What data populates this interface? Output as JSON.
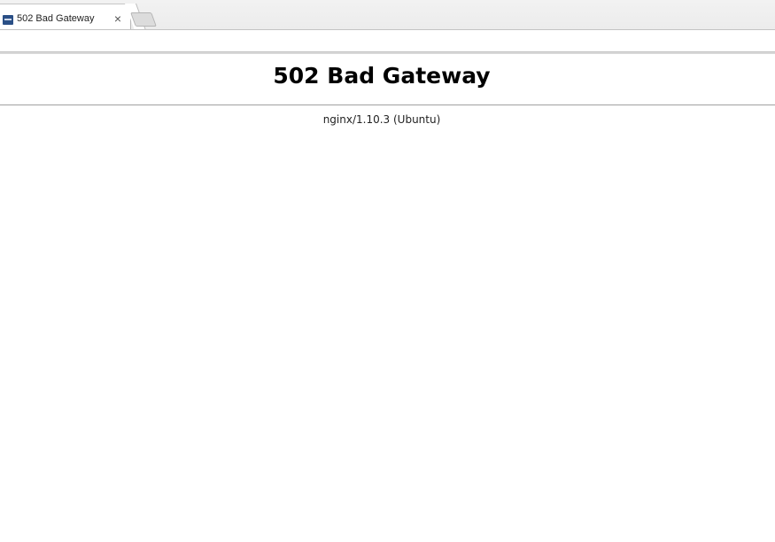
{
  "browser": {
    "tab": {
      "title": "502 Bad Gateway",
      "close_glyph": "×",
      "favicon": "page-favicon-icon"
    },
    "new_tab_icon": "new-tab-icon"
  },
  "page": {
    "heading": "502 Bad Gateway",
    "server_info": "nginx/1.10.3 (Ubuntu)"
  }
}
